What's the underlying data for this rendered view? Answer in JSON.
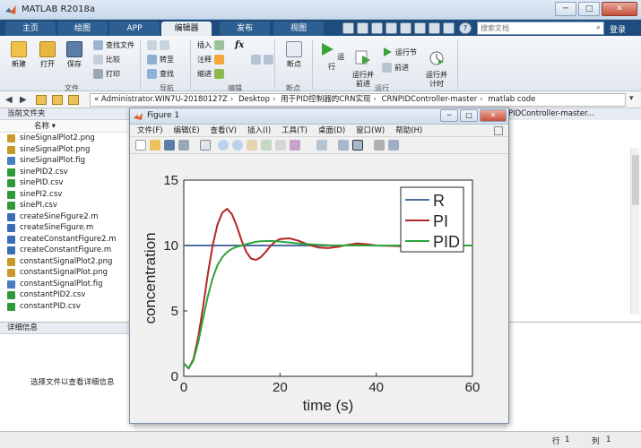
{
  "app": {
    "title": "MATLAB R2018a"
  },
  "ribbon": {
    "tabs": [
      "主页",
      "绘图",
      "APP",
      "编辑器",
      "发布",
      "视图"
    ],
    "active_tab": "编辑器",
    "search_placeholder": "搜索文档",
    "login": "登录",
    "file_group": {
      "new": "新建",
      "open": "打开",
      "save": "保存",
      "find_files": "查找文件",
      "compare": "比较",
      "print": "打印",
      "label": "文件"
    },
    "nav_group": {
      "goto": "转至",
      "find": "查找",
      "label": "导航"
    },
    "edit_group": {
      "insert": "插入",
      "comment": "注释",
      "indent": "缩进",
      "fx": "fx",
      "label": "编辑"
    },
    "breakpoint_group": {
      "breakpoints": "断点",
      "label": "断点"
    },
    "run_group": {
      "run": "运行",
      "run_advance": "运行并\n前进",
      "run_section": "运行节",
      "advance": "前进",
      "run_time": "运行并\n计时",
      "label": "运行"
    }
  },
  "address": {
    "path": [
      "«",
      "Administrator.WIN7U-20180127Z",
      "Desktop",
      "用于PID控制器的CRN实现",
      "CRNPIDController-master",
      "matlab code"
    ]
  },
  "current_folder": {
    "header": "当前文件夹",
    "column": "名称",
    "files": [
      {
        "name": "sineSignalPlot2.png",
        "type": "png"
      },
      {
        "name": "sineSignalPlot.png",
        "type": "png"
      },
      {
        "name": "sineSignalPlot.fig",
        "type": "fig"
      },
      {
        "name": "sinePID2.csv",
        "type": "csv"
      },
      {
        "name": "sinePID.csv",
        "type": "csv"
      },
      {
        "name": "sinePI2.csv",
        "type": "csv"
      },
      {
        "name": "sinePI.csv",
        "type": "csv"
      },
      {
        "name": "createSineFigure2.m",
        "type": "m"
      },
      {
        "name": "createSineFigure.m",
        "type": "m"
      },
      {
        "name": "createConstantFigure2.m",
        "type": "m"
      },
      {
        "name": "createConstantFigure.m",
        "type": "m"
      },
      {
        "name": "constantSignalPlot2.png",
        "type": "png"
      },
      {
        "name": "constantSignalPlot.png",
        "type": "png"
      },
      {
        "name": "constantSignalPlot.fig",
        "type": "fig"
      },
      {
        "name": "constantPID2.csv",
        "type": "csv"
      },
      {
        "name": "constantPID.csv",
        "type": "csv"
      }
    ]
  },
  "details": {
    "header": "详细信息",
    "message": "选择文件以查看详细信息"
  },
  "right_panel": {
    "header": "PIDController-master..."
  },
  "status": {
    "row_label": "行",
    "row": "1",
    "col_label": "列",
    "col": "1"
  },
  "colors": {
    "ribbon_tab_bg": "#1e4c7d",
    "file_m": "#3b6fb5",
    "file_csv": "#2f9a3a",
    "file_png": "#c79a2a",
    "file_fig": "#4a7cc0"
  },
  "figure": {
    "title": "Figure 1",
    "menus": [
      "文件(F)",
      "编辑(E)",
      "查看(V)",
      "插入(I)",
      "工具(T)",
      "桌面(D)",
      "窗口(W)",
      "帮助(H)"
    ]
  },
  "chart_data": {
    "type": "line",
    "xlabel": "time (s)",
    "ylabel": "concentration",
    "xlim": [
      0,
      60
    ],
    "ylim": [
      0,
      15
    ],
    "xticks": [
      "0",
      "20",
      "40",
      "60"
    ],
    "yticks": [
      "0",
      "5",
      "10",
      "15"
    ],
    "legend_position": "top-right",
    "grid": false,
    "series": [
      {
        "name": "R",
        "color": "#4e6fa0",
        "x": [
          0,
          60
        ],
        "y": [
          10,
          10
        ]
      },
      {
        "name": "PI",
        "color": "#b52525",
        "x": [
          0,
          1,
          2,
          3,
          4,
          5,
          6,
          7,
          8,
          9,
          10,
          11,
          12,
          13,
          14,
          15,
          16,
          17,
          18,
          19,
          20,
          22,
          24,
          26,
          28,
          30,
          32,
          34,
          36,
          38,
          40,
          45,
          50,
          55,
          60
        ],
        "y": [
          1,
          0.6,
          1.3,
          3.0,
          5.3,
          7.8,
          10.0,
          11.6,
          12.5,
          12.8,
          12.4,
          11.5,
          10.4,
          9.5,
          9.0,
          8.9,
          9.1,
          9.5,
          9.95,
          10.3,
          10.5,
          10.55,
          10.35,
          10.05,
          9.85,
          9.8,
          9.9,
          10.05,
          10.15,
          10.1,
          10.0,
          9.95,
          10.02,
          10.0,
          10.0
        ]
      },
      {
        "name": "PID",
        "color": "#2ea43a",
        "x": [
          0,
          1,
          2,
          3,
          4,
          5,
          6,
          7,
          8,
          9,
          10,
          11,
          12,
          13,
          14,
          15,
          16,
          18,
          20,
          22,
          24,
          26,
          28,
          30,
          35,
          40,
          45,
          50,
          55,
          60
        ],
        "y": [
          1,
          0.6,
          1.2,
          2.6,
          4.4,
          6.1,
          7.5,
          8.5,
          9.1,
          9.5,
          9.75,
          9.9,
          10.0,
          10.1,
          10.2,
          10.28,
          10.32,
          10.35,
          10.3,
          10.22,
          10.15,
          10.1,
          10.05,
          10.02,
          10.0,
          10.0,
          10.0,
          10.0,
          10.0,
          10.0
        ]
      }
    ]
  }
}
